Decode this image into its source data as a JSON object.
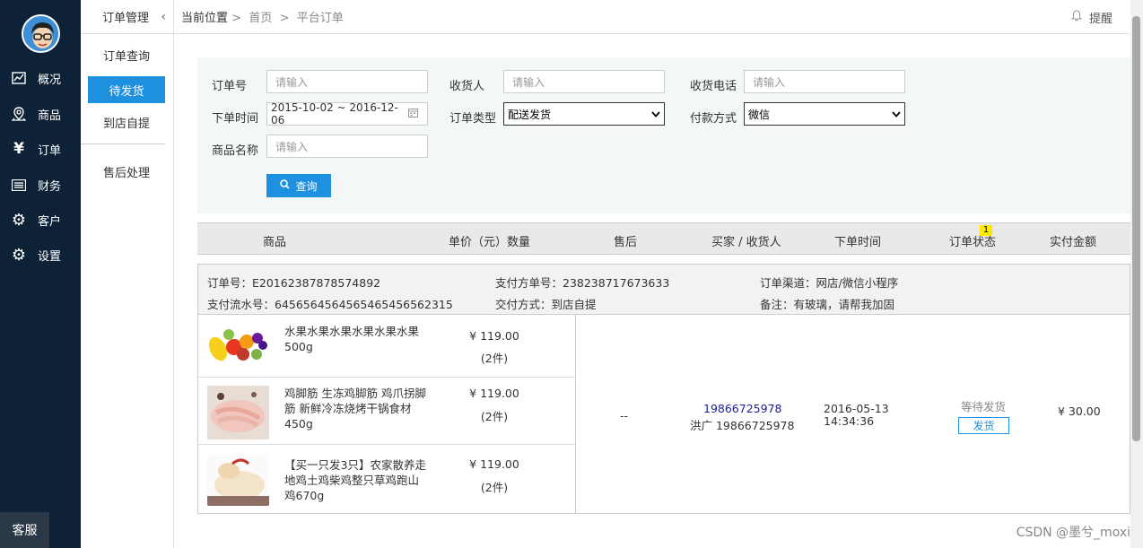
{
  "nav": {
    "items": [
      {
        "label": "概况",
        "icon": "chart-icon"
      },
      {
        "label": "商品",
        "icon": "location-icon"
      },
      {
        "label": "订单",
        "icon": "yen-icon"
      },
      {
        "label": "财务",
        "icon": "list-icon"
      },
      {
        "label": "客户",
        "icon": "gear-icon"
      },
      {
        "label": "设置",
        "icon": "gear-icon"
      }
    ],
    "kefu": "客服"
  },
  "subnav": {
    "title": "订单管理",
    "items": [
      "订单查询",
      "待发货",
      "到店自提",
      "售后处理"
    ]
  },
  "breadcrumb": {
    "prefix": "当前位置",
    "sep": ">",
    "home": "首页",
    "current": "平台订单"
  },
  "remind": "提醒",
  "filter": {
    "order_no_label": "订单号",
    "order_no_ph": "请输入",
    "receiver_label": "收货人",
    "receiver_ph": "请输入",
    "phone_label": "收货电话",
    "phone_ph": "请输入",
    "time_label": "下单时间",
    "time_value": "2015-10-02 ~ 2016-12-06",
    "type_label": "订单类型",
    "type_value": "配送发货",
    "pay_label": "付款方式",
    "pay_value": "微信",
    "product_label": "商品名称",
    "product_ph": "请输入",
    "query": "查询"
  },
  "table": {
    "headers": [
      "商品",
      "单价（元）数量",
      "售后",
      "买家 / 收货人",
      "下单时间",
      "订单状态",
      "实付金额"
    ],
    "status_badge": "1"
  },
  "order": {
    "order_no": "订单号：E20162387878574892",
    "payer_no": "支付方单号：238238717673633",
    "channel": "订单渠道：网店/微信小程序",
    "flow_no": "支付流水号：6456564564565465456562315",
    "delivery": "交付方式：到店自提",
    "remark": "备注：有玻璃，请帮我加固",
    "products": [
      {
        "name": "水果水果水果水果水果水果500g",
        "price": "¥ 119.00",
        "qty": "(2件)"
      },
      {
        "name": "鸡脚筋 生冻鸡脚筋 鸡爪拐脚筋 新鲜冷冻烧烤干锅食材450g",
        "price": "¥ 119.00",
        "qty": "(2件)"
      },
      {
        "name": "【买一只发3只】农家散养走地鸡土鸡柴鸡整只草鸡跑山鸡670g",
        "price": "¥ 119.00",
        "qty": "(2件)"
      }
    ],
    "aftersale": "--",
    "buyer": "19866725978",
    "receiver": "洪广 19866725978",
    "date": "2016-05-13",
    "time": "14:34:36",
    "status": "等待发货",
    "ship": "发货",
    "amount": "¥ 30.00"
  },
  "watermark": "CSDN @墨兮_moxi"
}
